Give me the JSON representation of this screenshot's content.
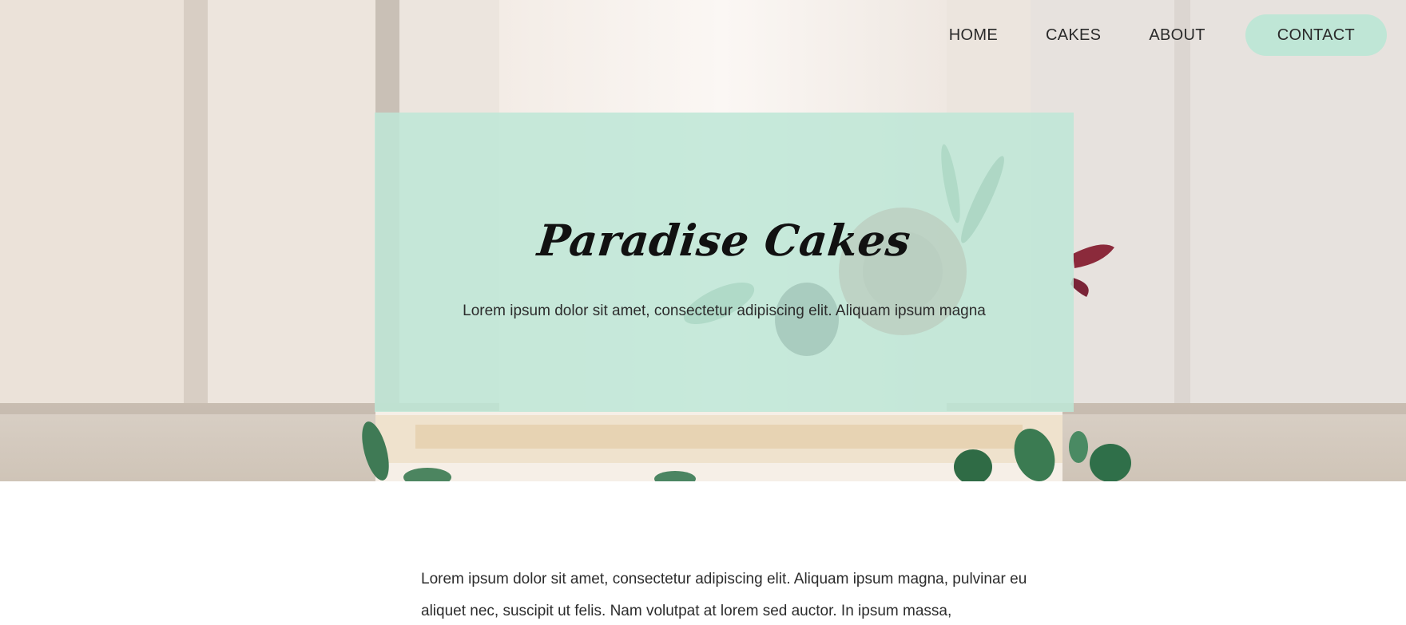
{
  "nav": {
    "items": [
      "HOME",
      "CAKES",
      "ABOUT"
    ],
    "cta_label": "CONTACT"
  },
  "hero": {
    "title": "Paradise Cakes",
    "subtitle": "Lorem ipsum dolor sit amet, consectetur adipiscing elit. Aliquam ipsum magna",
    "image": "cake-photo-background"
  },
  "intro": {
    "text": "Lorem ipsum dolor sit amet, consectetur adipiscing elit. Aliquam ipsum magna, pulvinar eu aliquet nec, suscipit ut felis. Nam volutpat at lorem sed auctor. In ipsum massa,"
  },
  "colors": {
    "accent": "#bfe6d6",
    "text": "#2b2b2b",
    "title": "#111111"
  }
}
